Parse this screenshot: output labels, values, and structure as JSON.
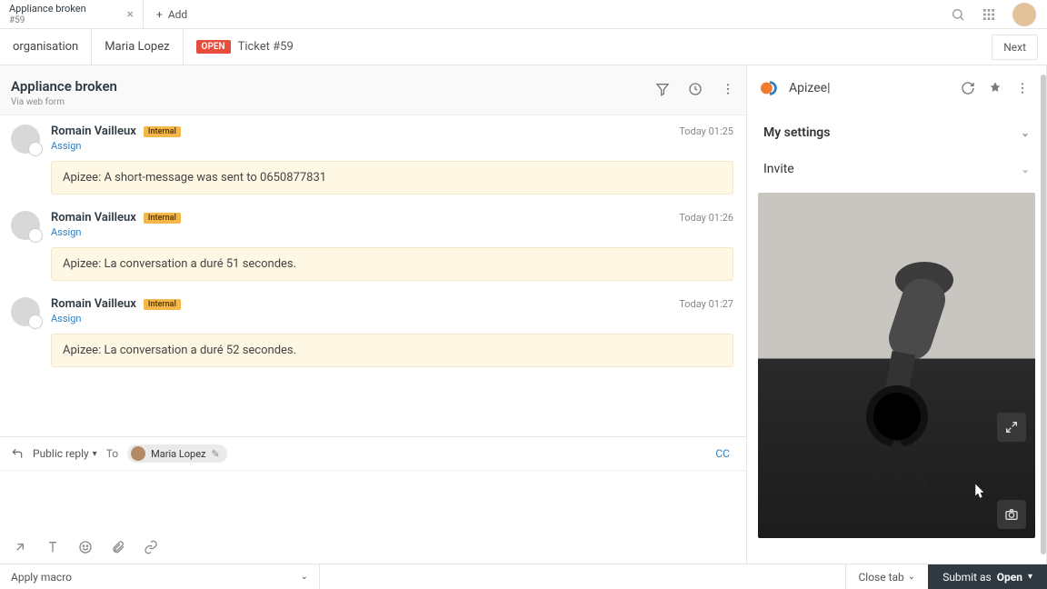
{
  "topbar": {
    "tab": {
      "title": "Appliance broken",
      "sub": "#59"
    },
    "add_label": "Add"
  },
  "breadcrumb": {
    "org": "organisation",
    "user": "Maria Lopez",
    "status_badge": "OPEN",
    "ticket": "Ticket #59",
    "next": "Next"
  },
  "ticket": {
    "title": "Appliance broken",
    "via": "Via web form"
  },
  "messages": [
    {
      "author": "Romain Vailleux",
      "badge": "Internal",
      "assign": "Assign",
      "time": "Today 01:25",
      "content": "Apizee: A short-message was sent to 0650877831"
    },
    {
      "author": "Romain Vailleux",
      "badge": "Internal",
      "assign": "Assign",
      "time": "Today 01:26",
      "content": "Apizee: La conversation a duré 51 secondes."
    },
    {
      "author": "Romain Vailleux",
      "badge": "Internal",
      "assign": "Assign",
      "time": "Today 01:27",
      "content": "Apizee: La conversation a duré 52 secondes."
    }
  ],
  "reply": {
    "mode": "Public reply",
    "to_label": "To",
    "to_name": "Maria Lopez",
    "cc": "CC"
  },
  "sidebar": {
    "app_title": "Apizee|",
    "sections": {
      "settings": "My settings",
      "invite": "Invite"
    }
  },
  "footer": {
    "macro": "Apply macro",
    "close_tab": "Close tab",
    "submit_prefix": "Submit as ",
    "submit_status": "Open"
  }
}
